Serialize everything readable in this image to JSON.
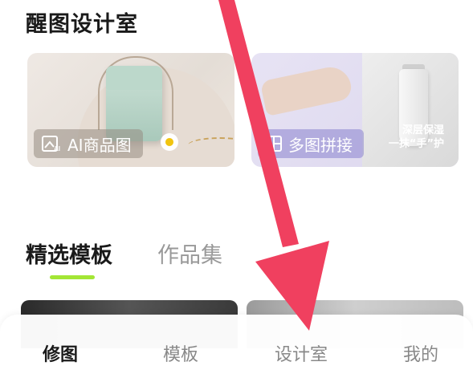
{
  "section": {
    "title": "醒图设计室"
  },
  "cards": [
    {
      "label": "AI商品图",
      "icon": "ai-image-icon"
    },
    {
      "label": "多图拼接",
      "icon": "collage-icon",
      "promo_line1": "深层保湿",
      "promo_line2": "一抹“手”护"
    }
  ],
  "tabs": [
    {
      "label": "精选模板",
      "active": true
    },
    {
      "label": "作品集",
      "active": false
    }
  ],
  "bottom_nav": {
    "items": [
      {
        "label": "修图",
        "active": true
      },
      {
        "label": "模板",
        "active": false
      },
      {
        "label": "设计室",
        "active": false
      },
      {
        "label": "我的",
        "active": false
      }
    ]
  },
  "colors": {
    "accent": "#a3e635",
    "arrow": "#f0405f",
    "text_primary": "#1a1a1a",
    "text_muted": "#888888"
  }
}
